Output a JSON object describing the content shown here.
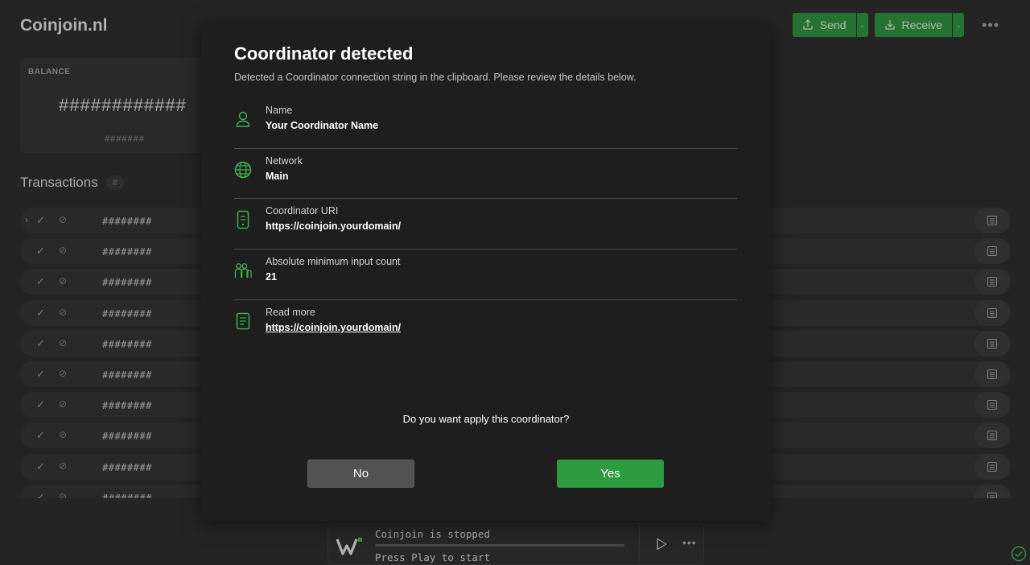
{
  "wallet": {
    "title": "Coinjoin.nl",
    "send_label": "Send",
    "receive_label": "Receive",
    "more_label": "•••"
  },
  "balance": {
    "label": "BALANCE",
    "amount": "############",
    "fiat": "#######"
  },
  "transactions": {
    "heading": "Transactions",
    "rows": [
      {
        "hash": "########"
      },
      {
        "hash": "########"
      },
      {
        "hash": "########"
      },
      {
        "hash": "########"
      },
      {
        "hash": "########"
      },
      {
        "hash": "########"
      },
      {
        "hash": "########"
      },
      {
        "hash": "########"
      },
      {
        "hash": "########"
      },
      {
        "hash": "########"
      }
    ]
  },
  "coinjoin": {
    "status": "Coinjoin is stopped",
    "hint": "Press Play to start",
    "progress": 0,
    "more_label": "•••"
  },
  "dialog": {
    "title": "Coordinator detected",
    "subtitle": "Detected a Coordinator connection string in the clipboard. Please review the details below.",
    "details": [
      {
        "icon": "person-icon",
        "label": "Name",
        "value": "Your Coordinator Name"
      },
      {
        "icon": "globe-icon",
        "label": "Network",
        "value": "Main"
      },
      {
        "icon": "server-icon",
        "label": "Coordinator URI",
        "value": "https://coinjoin.yourdomain/"
      },
      {
        "icon": "people-icon",
        "label": "Absolute minimum input count",
        "value": "21"
      },
      {
        "icon": "document-icon",
        "label": "Read more",
        "value": "https://coinjoin.yourdomain/"
      }
    ],
    "question": "Do you want apply this coordinator?",
    "no_label": "No",
    "yes_label": "Yes"
  },
  "colors": {
    "accent": "#2e9b3f",
    "icon_green": "#3fb24f",
    "dialog_bg": "#1e1e1e",
    "app_bg": "#2c2c2c"
  }
}
